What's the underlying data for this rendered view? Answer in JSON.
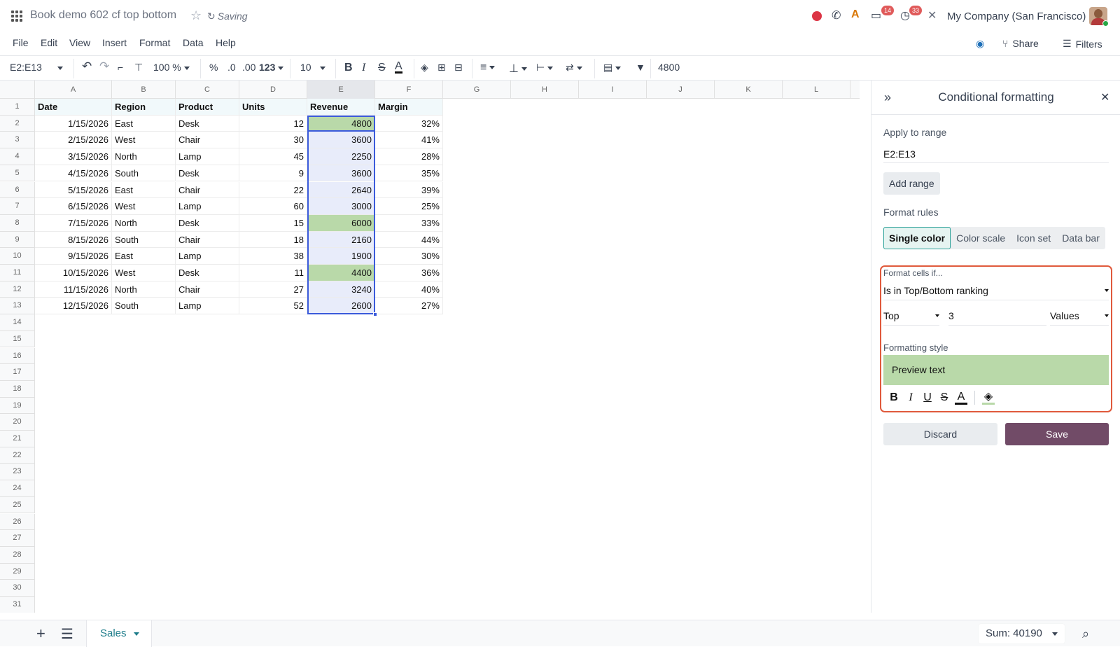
{
  "app": {
    "doc_title": "Book demo 602 cf top bottom",
    "saving_label": "Saving",
    "company": "My Company (San Francisco)",
    "badges": {
      "messages": "14",
      "activities": "33"
    }
  },
  "menu": {
    "items": [
      "File",
      "Edit",
      "View",
      "Insert",
      "Format",
      "Data",
      "Help"
    ],
    "share_label": "Share",
    "filters_label": "Filters"
  },
  "toolbar": {
    "cell_ref": "E2:E13",
    "zoom": "100 %",
    "percent": "%",
    "dec_decrease": ".0",
    "dec_increase": ".00",
    "number_format": "123",
    "font_size": "10",
    "formula_value": "4800"
  },
  "sheet": {
    "columns": [
      "A",
      "B",
      "C",
      "D",
      "E",
      "F",
      "G",
      "H",
      "I",
      "J",
      "K",
      "L"
    ],
    "row_count": 31,
    "headers": [
      "Date",
      "Region",
      "Product",
      "Units",
      "Revenue",
      "Margin"
    ],
    "rows": [
      [
        "1/15/2026",
        "East",
        "Desk",
        "12",
        "4800",
        "32%"
      ],
      [
        "2/15/2026",
        "West",
        "Chair",
        "30",
        "3600",
        "41%"
      ],
      [
        "3/15/2026",
        "North",
        "Lamp",
        "45",
        "2250",
        "28%"
      ],
      [
        "4/15/2026",
        "South",
        "Desk",
        "9",
        "3600",
        "35%"
      ],
      [
        "5/15/2026",
        "East",
        "Chair",
        "22",
        "2640",
        "39%"
      ],
      [
        "6/15/2026",
        "West",
        "Lamp",
        "60",
        "3000",
        "25%"
      ],
      [
        "7/15/2026",
        "North",
        "Desk",
        "15",
        "6000",
        "33%"
      ],
      [
        "8/15/2026",
        "South",
        "Chair",
        "18",
        "2160",
        "44%"
      ],
      [
        "9/15/2026",
        "East",
        "Lamp",
        "38",
        "1900",
        "30%"
      ],
      [
        "10/15/2026",
        "West",
        "Desk",
        "11",
        "4400",
        "36%"
      ],
      [
        "11/15/2026",
        "North",
        "Chair",
        "27",
        "3240",
        "40%"
      ],
      [
        "12/15/2026",
        "South",
        "Lamp",
        "52",
        "2600",
        "27%"
      ]
    ],
    "highlighted_revenue": [
      "4800",
      "6000",
      "4400"
    ],
    "highlight_color": "#b9d9a9"
  },
  "sidebar": {
    "title": "Conditional formatting",
    "apply_label": "Apply to range",
    "range_value": "E2:E13",
    "add_range_label": "Add range",
    "format_rules_label": "Format rules",
    "tabs": [
      "Single color",
      "Color scale",
      "Icon set",
      "Data bar"
    ],
    "active_tab": "Single color",
    "format_cells_if_label": "Format cells if...",
    "condition": "Is in Top/Bottom ranking",
    "rank_direction": "Top",
    "rank_count": "3",
    "rank_unit": "Values",
    "formatting_style_label": "Formatting style",
    "preview_text": "Preview text",
    "preview_color": "#b9d9a9",
    "discard_label": "Discard",
    "save_label": "Save",
    "save_color": "#714b67"
  },
  "bottom": {
    "sheet_name": "Sales",
    "sum_label": "Sum: 40190"
  }
}
